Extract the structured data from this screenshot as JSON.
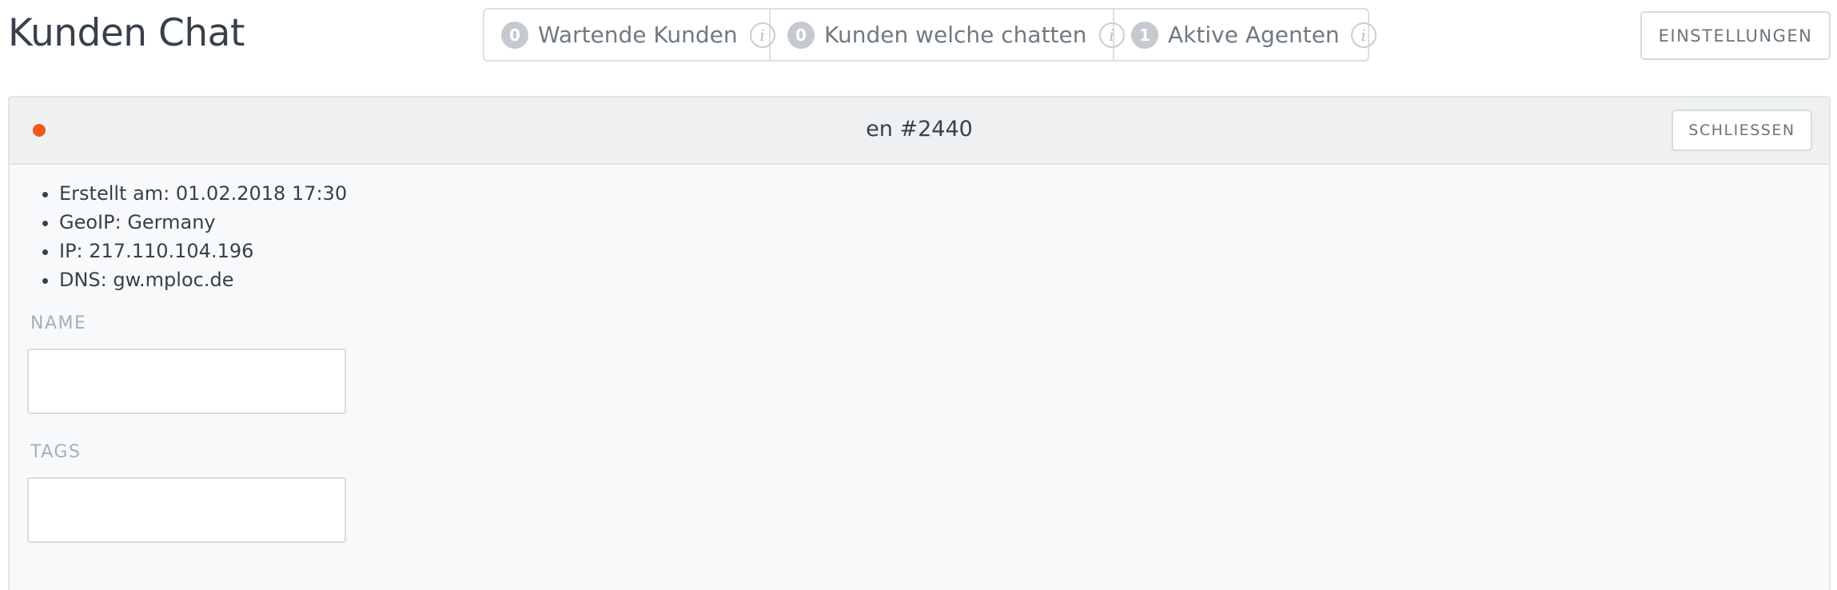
{
  "header": {
    "title": "Kunden Chat",
    "status": [
      {
        "count": "0",
        "label": "Wartende Kunden",
        "icon": "info-icon"
      },
      {
        "count": "0",
        "label": "Kunden welche chatten",
        "icon": "info-icon"
      },
      {
        "count": "1",
        "label": "Aktive Agenten",
        "icon": "info-icon"
      }
    ],
    "settings_label": "EINSTELLUNGEN",
    "info_glyph": "i"
  },
  "chat": {
    "title": "en #2440",
    "status_color": "#f0581f",
    "close_label": "SCHLIESSEN",
    "details": [
      "Erstellt am: 01.02.2018 17:30",
      "GeoIP: Germany",
      "IP: 217.110.104.196",
      "DNS: gw.mploc.de"
    ],
    "name_label": "NAME",
    "name_value": "",
    "tags_label": "TAGS",
    "tags_value": ""
  }
}
